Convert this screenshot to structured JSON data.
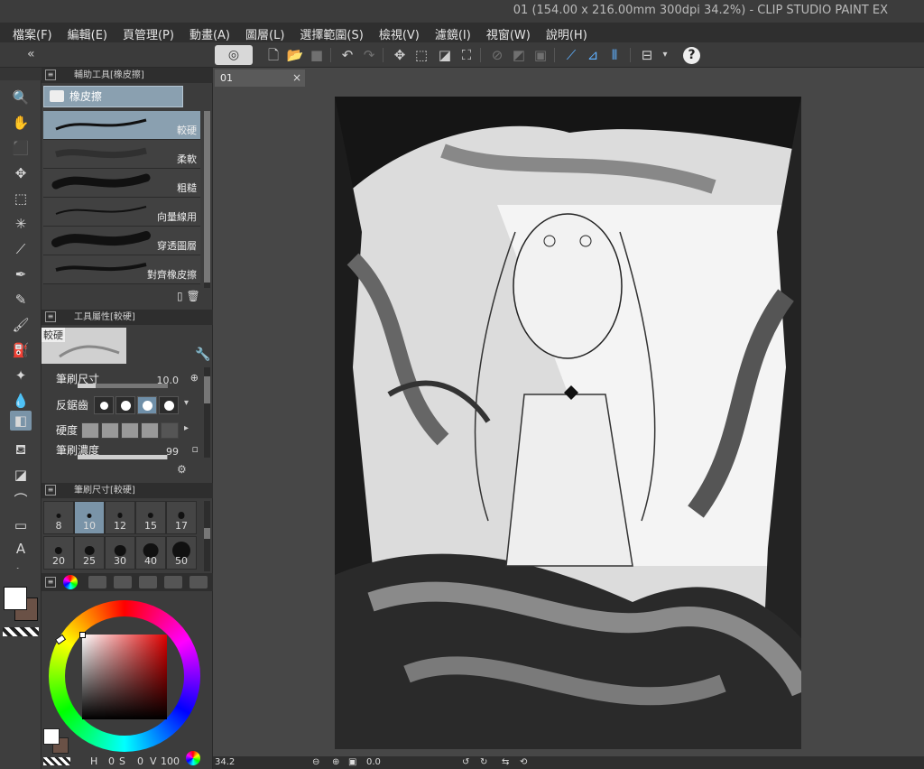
{
  "window": {
    "title": "01 (154.00 x 216.00mm 300dpi 34.2%)  - CLIP STUDIO PAINT EX"
  },
  "menu": [
    {
      "label": "檔案(F)"
    },
    {
      "label": "編輯(E)"
    },
    {
      "label": "頁管理(P)"
    },
    {
      "label": "動畫(A)"
    },
    {
      "label": "圖層(L)"
    },
    {
      "label": "選擇範圍(S)"
    },
    {
      "label": "檢視(V)"
    },
    {
      "label": "濾鏡(I)"
    },
    {
      "label": "視窗(W)"
    },
    {
      "label": "說明(H)"
    }
  ],
  "command_bar": {
    "help_glyph": "?"
  },
  "subtool_panel": {
    "header": "輔助工具[橡皮擦]",
    "group": "橡皮擦",
    "brushes": [
      {
        "label": "較硬"
      },
      {
        "label": "柔軟"
      },
      {
        "label": "粗糙"
      },
      {
        "label": "向量線用"
      },
      {
        "label": "穿透圖層"
      },
      {
        "label": "對齊橡皮擦"
      }
    ]
  },
  "tool_property": {
    "header": "工具屬性[較硬]",
    "preview_label": "較硬",
    "brush_size_label": "筆刷尺寸",
    "brush_size_value": "10.0",
    "brush_size_fraction": 0.2,
    "antialias_label": "反鋸齒",
    "antialias_selected_index": 2,
    "hardness_label": "硬度",
    "density_label": "筆刷濃度",
    "density_value": "99",
    "density_fraction": 0.99
  },
  "brush_size_panel": {
    "header": "筆刷尺寸[較硬]",
    "sizes": [
      "8",
      "10",
      "12",
      "15",
      "17",
      "20",
      "25",
      "30",
      "40",
      "50"
    ],
    "selected": "10"
  },
  "color_panel": {
    "main_color": "#ffffff",
    "sub_color": "#6a5146",
    "h_label": "H",
    "h_value": "0",
    "s_label": "S",
    "s_value": "0",
    "v_label": "V",
    "v_value": "100"
  },
  "canvas": {
    "doc_tab": "01",
    "close_glyph": "×"
  },
  "status_bar": {
    "zoom": "34.2",
    "angle": "0.0"
  },
  "accent": "#8aa0b0"
}
